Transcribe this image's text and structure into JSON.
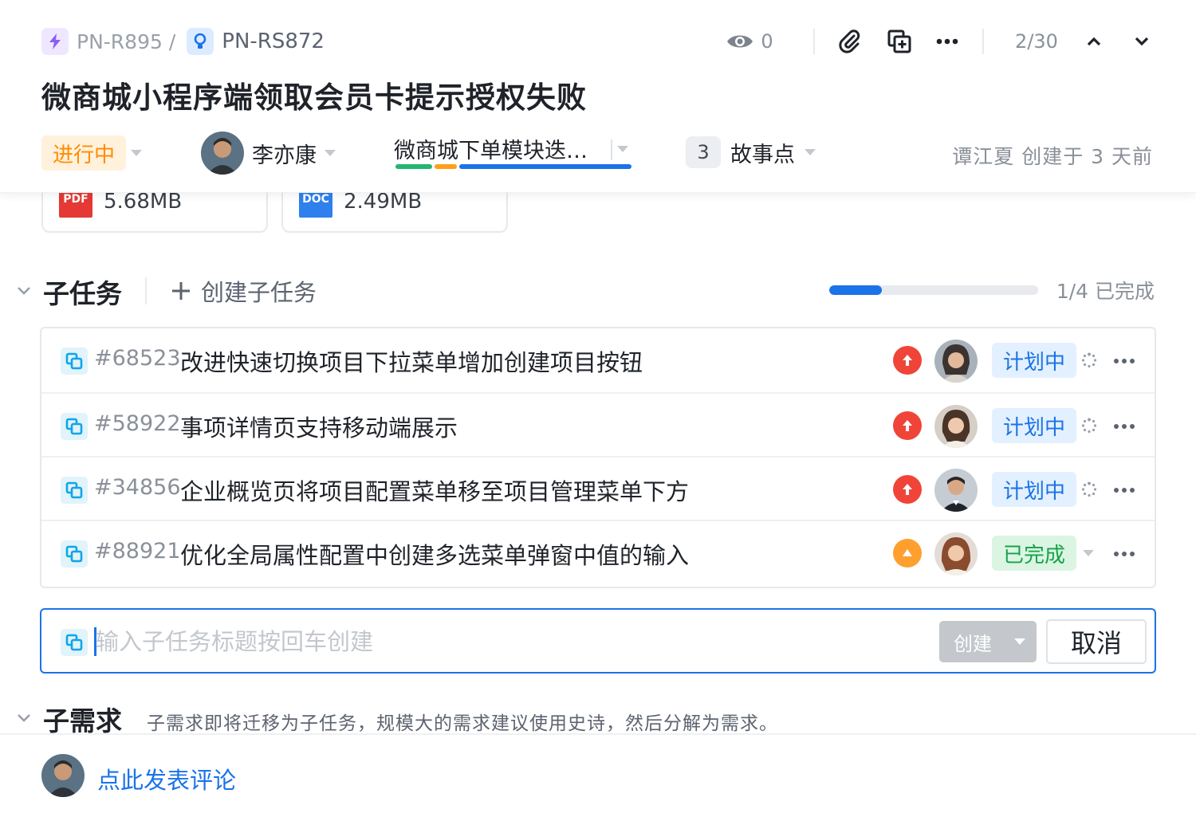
{
  "breadcrumb": {
    "parent_id": "PN-R895 /",
    "current_id": "PN-RS872"
  },
  "toolbar": {
    "watch_count": "0",
    "pager": "2/30"
  },
  "title": "微商城小程序端领取会员卡提示授权失败",
  "meta": {
    "status": "进行中",
    "status_color": "#ff8b00",
    "assignee": "李亦康",
    "sprint": "微商城下单模块迭…",
    "story_points": "3",
    "story_points_label": "故事点",
    "creator_text": "谭江夏 创建于 3 天前"
  },
  "attachments": [
    {
      "type": "PDF",
      "size": "5.68MB",
      "color": "#e53935"
    },
    {
      "type": "DOC",
      "size": "2.49MB",
      "color": "#2f80ed"
    }
  ],
  "subtasks": {
    "title": "子任务",
    "create_label": "创建子任务",
    "progress": 0.25,
    "progress_text": "1/4 已完成",
    "items": [
      {
        "id": "#68523",
        "title": "改进快速切换项目下拉菜单增加创建项目按钮",
        "priority": "high",
        "priority_color": "#f04438",
        "status": "计划中",
        "status_kind": "plan"
      },
      {
        "id": "#58922",
        "title": "事项详情页支持移动端展示",
        "priority": "high",
        "priority_color": "#f04438",
        "status": "计划中",
        "status_kind": "plan"
      },
      {
        "id": "#34856",
        "title": "企业概览页将项目配置菜单移至项目管理菜单下方",
        "priority": "high",
        "priority_color": "#f04438",
        "status": "计划中",
        "status_kind": "plan"
      },
      {
        "id": "#88921",
        "title": "优化全局属性配置中创建多选菜单弹窗中值的输入",
        "priority": "medium",
        "priority_color": "#ff9f2e",
        "status": "已完成",
        "status_kind": "done"
      }
    ],
    "new_placeholder": "输入子任务标题按回车创建",
    "create_button": "创建",
    "cancel_button": "取消"
  },
  "subrequirements": {
    "title": "子需求",
    "hint": "子需求即将迁移为子任务，规模大的需求建议使用史诗，然后分解为需求。"
  },
  "footer": {
    "comment_link": "点此发表评论"
  },
  "colors": {
    "accent": "#1a73e8",
    "sprint_segments": [
      "#22b573",
      "#ff9f1a",
      "#1a73e8"
    ]
  }
}
